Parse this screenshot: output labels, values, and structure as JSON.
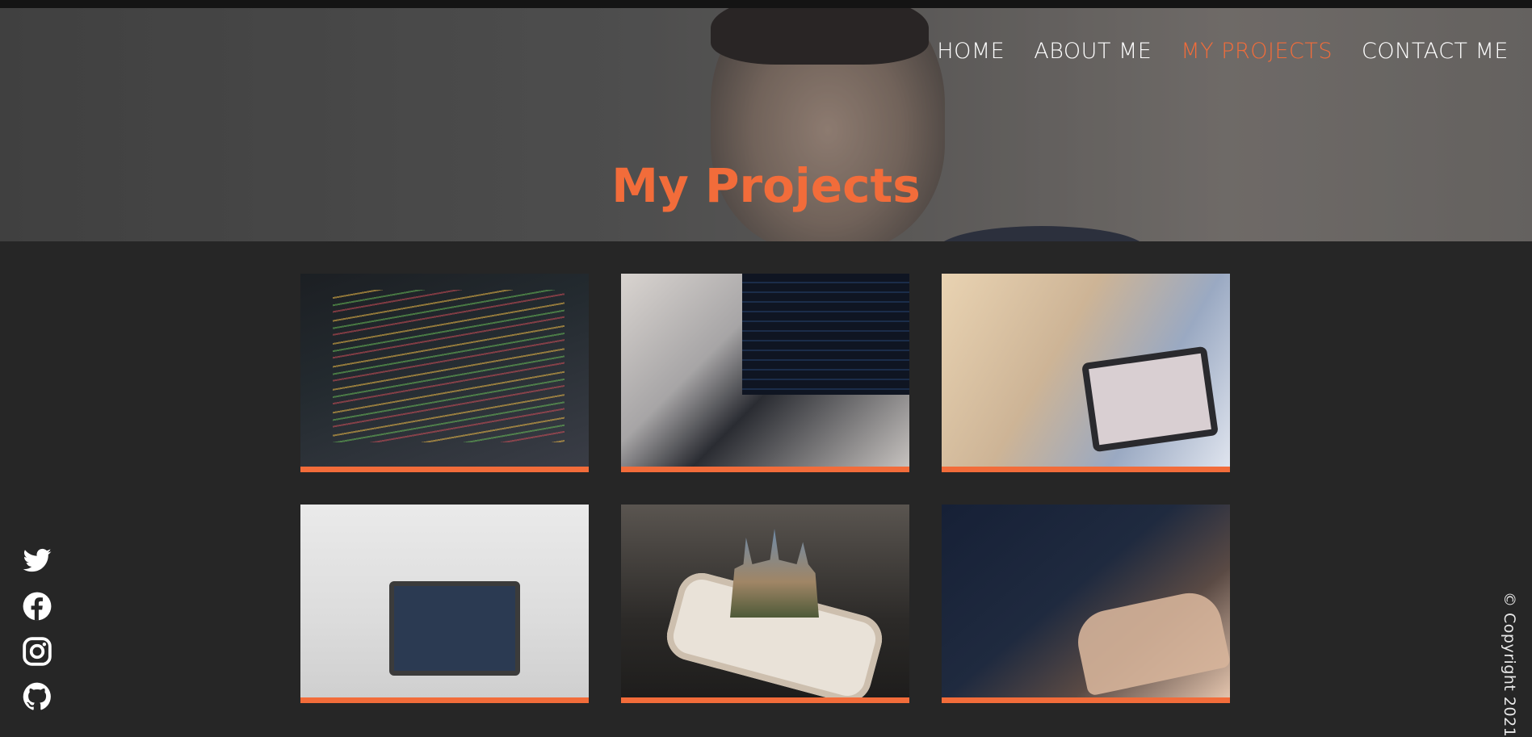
{
  "nav": {
    "items": [
      {
        "label": "HOME",
        "active": false
      },
      {
        "label": "ABOUT ME",
        "active": false
      },
      {
        "label": "MY PROJECTS",
        "active": true
      },
      {
        "label": "CONTACT ME",
        "active": false
      }
    ]
  },
  "hero": {
    "title": "My Projects"
  },
  "projects": [
    {
      "image": "code-editor-screen-image"
    },
    {
      "image": "laptop-with-code-image"
    },
    {
      "image": "tablet-in-hands-image"
    },
    {
      "image": "laptop-on-desk-image"
    },
    {
      "image": "phone-with-castle-image"
    },
    {
      "image": "hands-typing-laptop-image"
    }
  ],
  "social": {
    "icons": [
      "twitter-icon",
      "facebook-icon",
      "instagram-icon",
      "github-icon"
    ]
  },
  "footer": {
    "copyright": "© Copyright 2021"
  },
  "colors": {
    "accent": "#f26c3a",
    "background": "#262626",
    "nav_text": "#ffffff"
  }
}
